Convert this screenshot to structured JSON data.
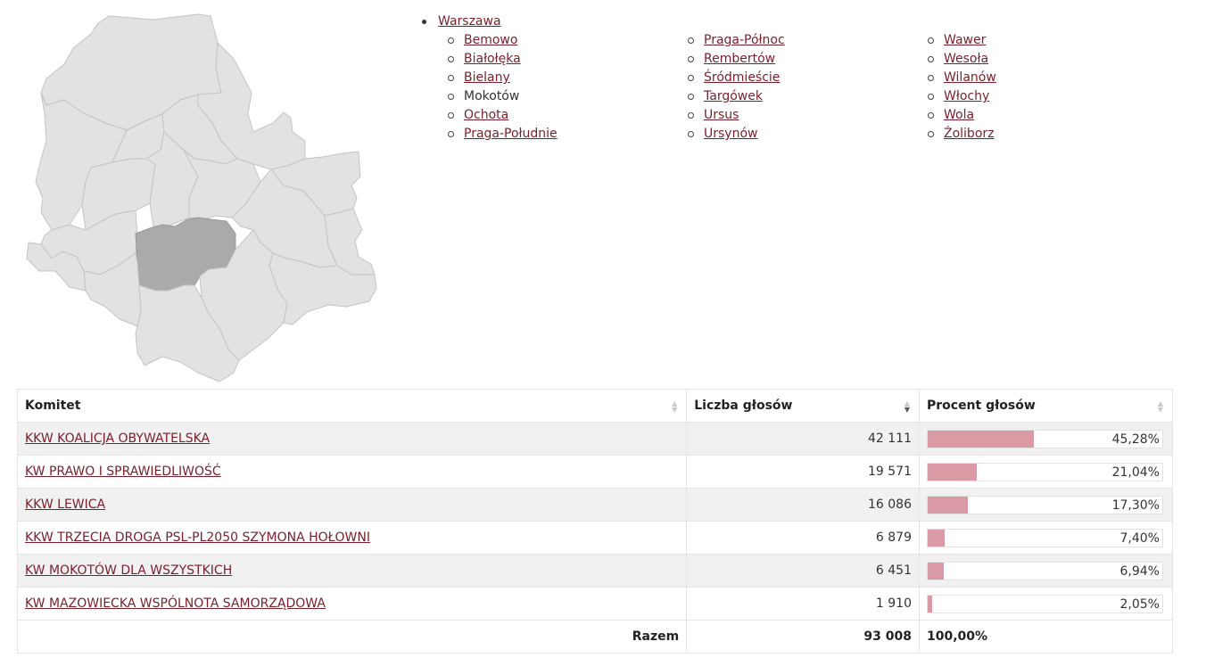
{
  "nav": {
    "root": "Warszawa",
    "columns": [
      [
        "Bemowo",
        "Białołęka",
        "Bielany",
        "Mokotów",
        "Ochota",
        "Praga-Południe"
      ],
      [
        "Praga-Północ",
        "Rembertów",
        "Śródmieście",
        "Targówek",
        "Ursus",
        "Ursynów"
      ],
      [
        "Wawer",
        "Wesoła",
        "Wilanów",
        "Włochy",
        "Wola",
        "Żoliborz"
      ]
    ],
    "current": "Mokotów"
  },
  "table": {
    "headers": {
      "committee": "Komitet",
      "votes": "Liczba głosów",
      "percent": "Procent głosów"
    },
    "sorted_by": "votes",
    "rows": [
      {
        "committee": "KKW KOALICJA OBYWATELSKA",
        "votes": "42 111",
        "percent": "45,28%",
        "share": 45.28
      },
      {
        "committee": "KW PRAWO I SPRAWIEDLIWOŚĆ",
        "votes": "19 571",
        "percent": "21,04%",
        "share": 21.04
      },
      {
        "committee": "KKW LEWICA",
        "votes": "16 086",
        "percent": "17,30%",
        "share": 17.3
      },
      {
        "committee": "KKW TRZECIA DROGA PSL-PL2050 SZYMONA HOŁOWNI",
        "votes": "6 879",
        "percent": "7,40%",
        "share": 7.4
      },
      {
        "committee": "KW MOKOTÓW DLA WSZYSTKICH",
        "votes": "6 451",
        "percent": "6,94%",
        "share": 6.94
      },
      {
        "committee": "KW MAZOWIECKA WSPÓLNOTA SAMORZĄDOWA",
        "votes": "1 910",
        "percent": "2,05%",
        "share": 2.05
      }
    ],
    "footer": {
      "label": "Razem",
      "votes": "93 008",
      "percent": "100,00%"
    }
  },
  "colors": {
    "link": "#7a1f2b",
    "bar": "#d99aa6",
    "map_fill": "#e2e2e2",
    "map_active": "#aaaaaa"
  }
}
